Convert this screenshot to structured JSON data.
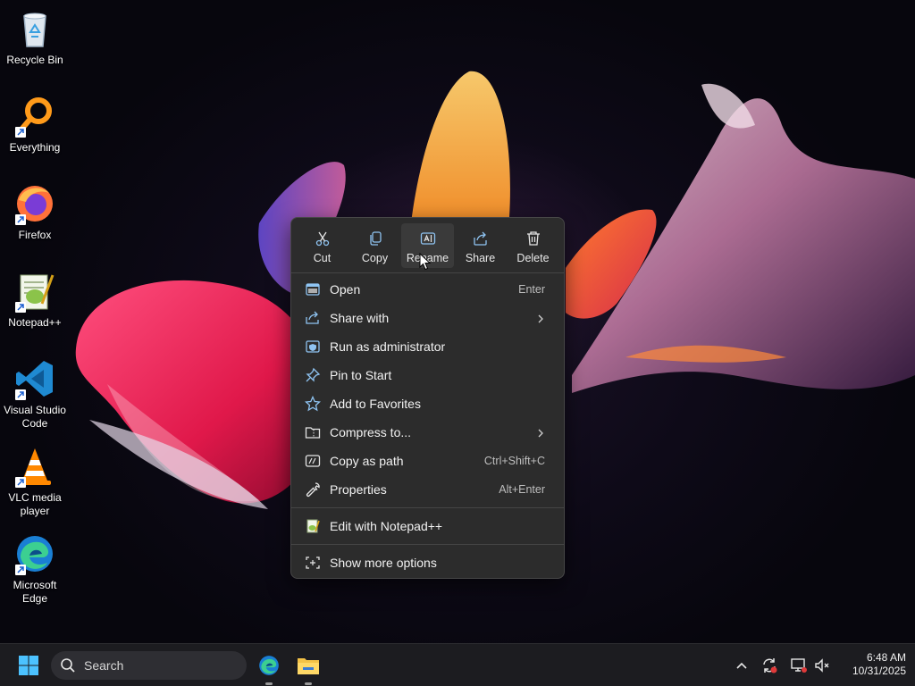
{
  "desktop": {
    "icons": [
      {
        "label": "Recycle Bin",
        "icon": "recycle-bin-icon"
      },
      {
        "label": "Everything",
        "icon": "everything-icon"
      },
      {
        "label": "Firefox",
        "icon": "firefox-icon"
      },
      {
        "label": "Notepad++",
        "icon": "notepadpp-icon"
      },
      {
        "label": "Visual Studio Code",
        "icon": "vscode-icon"
      },
      {
        "label": "VLC media player",
        "icon": "vlc-icon"
      },
      {
        "label": "Microsoft Edge",
        "icon": "edge-icon"
      }
    ]
  },
  "context_menu": {
    "quick_actions": [
      {
        "label": "Cut",
        "icon": "cut-icon"
      },
      {
        "label": "Copy",
        "icon": "copy-icon"
      },
      {
        "label": "Rename",
        "icon": "rename-icon",
        "hovered": true
      },
      {
        "label": "Share",
        "icon": "share-icon"
      },
      {
        "label": "Delete",
        "icon": "delete-icon"
      }
    ],
    "items": [
      {
        "label": "Open",
        "shortcut": "Enter",
        "icon": "open-icon"
      },
      {
        "label": "Share with",
        "shortcut": "",
        "icon": "share-with-icon",
        "submenu": true
      },
      {
        "label": "Run as administrator",
        "shortcut": "",
        "icon": "shield-icon"
      },
      {
        "label": "Pin to Start",
        "shortcut": "",
        "icon": "pin-icon"
      },
      {
        "label": "Add to Favorites",
        "shortcut": "",
        "icon": "star-icon"
      },
      {
        "label": "Compress to...",
        "shortcut": "",
        "icon": "zip-folder-icon",
        "submenu": true
      },
      {
        "label": "Copy as path",
        "shortcut": "Ctrl+Shift+C",
        "icon": "path-icon"
      },
      {
        "label": "Properties",
        "shortcut": "Alt+Enter",
        "icon": "wrench-icon"
      }
    ],
    "extra_items": [
      {
        "label": "Edit with Notepad++",
        "icon": "notepadpp-icon"
      }
    ],
    "more_items": [
      {
        "label": "Show more options",
        "icon": "show-more-icon"
      }
    ]
  },
  "taskbar": {
    "search_placeholder": "Search",
    "clock": {
      "time": "6:48 AM",
      "date": "10/31/2025"
    }
  },
  "colors": {
    "menu_bg": "#2c2c2c",
    "menu_hover": "#3a3a3a",
    "icon_accent": "#8fc4f2",
    "taskbar_bg": "#1c1c20"
  }
}
